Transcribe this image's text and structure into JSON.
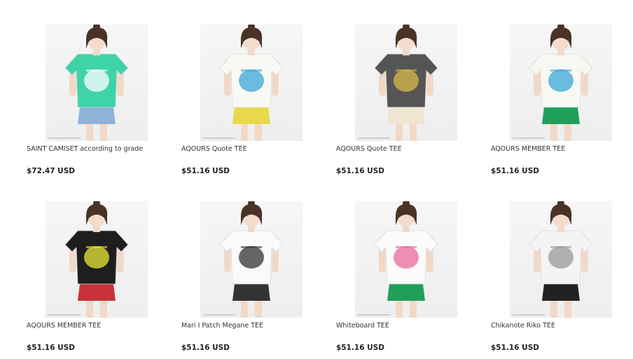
{
  "products": [
    {
      "title": "SAINT CAMISET according to grade",
      "price": "$72.47 USD",
      "shirt": "#3fd3a8",
      "accent": "#ffffff",
      "bottom": "#8fb3d8",
      "icon": "camisole-top-icon"
    },
    {
      "title": "AQOURS Quote TEE",
      "price": "$51.16 USD",
      "shirt": "#f8f8f4",
      "accent": "#3aa7d8",
      "bottom": "#e8d84a",
      "icon": "white-tee-blue-print-icon"
    },
    {
      "title": "AQOURS Quote TEE",
      "price": "$51.16 USD",
      "shirt": "#555555",
      "accent": "#d8b84a",
      "bottom": "#efe6d2",
      "icon": "gray-tee-gold-print-icon"
    },
    {
      "title": "AQOURS MEMBER TEE",
      "price": "$51.16 USD",
      "shirt": "#f7f7f3",
      "accent": "#3aa7d8",
      "bottom": "#1fa058",
      "icon": "white-tee-back-print-icon"
    },
    {
      "title": "AQOURS MEMBER TEE",
      "price": "$51.16 USD",
      "shirt": "#1e1e1e",
      "accent": "#e8e83a",
      "bottom": "#c8323a",
      "icon": "black-tee-neon-print-icon"
    },
    {
      "title": "Mari I Patch Megane TEE",
      "price": "$51.16 USD",
      "shirt": "#fafafa",
      "accent": "#333333",
      "bottom": "#333333",
      "icon": "white-tee-glasses-patch-icon"
    },
    {
      "title": "Whiteboard TEE",
      "price": "$51.16 USD",
      "shirt": "#fbfbf9",
      "accent": "#e86a9a",
      "bottom": "#1fa058",
      "icon": "whiteboard-print-tee-icon"
    },
    {
      "title": "Chikanote Riko TEE",
      "price": "$51.16 USD",
      "shirt": "#f4f4f4",
      "accent": "#999999",
      "bottom": "#222222",
      "icon": "striped-tee-icon"
    }
  ]
}
